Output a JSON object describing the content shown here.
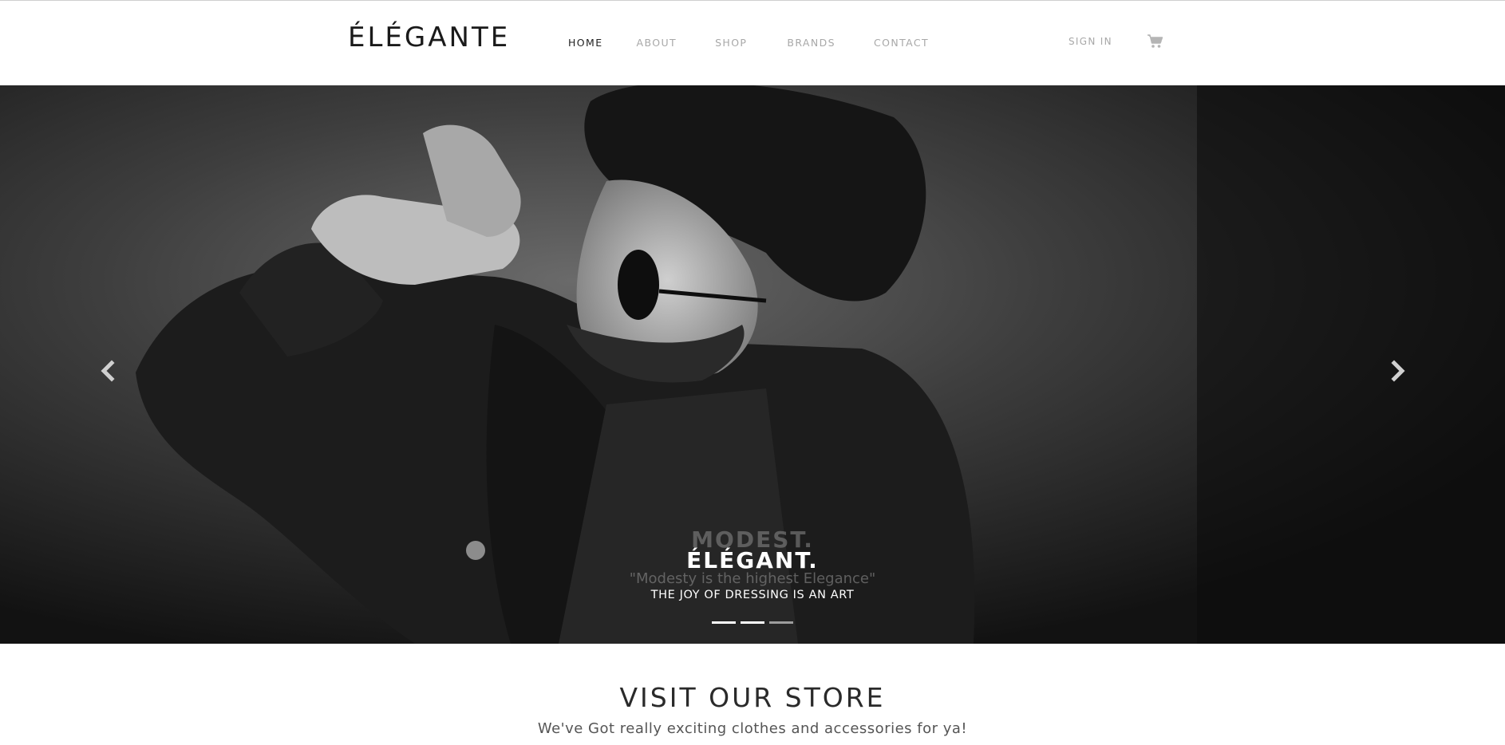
{
  "header": {
    "brand": "ÉLÉGANTE",
    "nav": [
      {
        "label": "HOME",
        "active": true
      },
      {
        "label": "ABOUT",
        "active": false
      },
      {
        "label": "SHOP",
        "active": false
      },
      {
        "label": "BRANDS",
        "active": false
      },
      {
        "label": "CONTACT",
        "active": false
      }
    ],
    "sign_in": "SIGN IN",
    "cart_icon": "shopping-cart-icon"
  },
  "hero": {
    "image_desc_icon": "hero-photo",
    "prev_icon": "chevron-left-icon",
    "next_icon": "chevron-right-icon",
    "ghost_title": "MODEST.",
    "title": "ÉLÉGANT.",
    "ghost_quote": "\"Modesty is the highest Elegance\"",
    "subtitle": "THE JOY OF DRESSING IS AN ART",
    "slides": 3,
    "active_slide": 2
  },
  "store": {
    "heading": "VISIT OUR STORE",
    "tagline": "We've Got really exciting clothes and accessories for ya!"
  },
  "colors": {
    "text_dark": "#1a1a1a",
    "nav_muted": "#a8a8a8",
    "hero_bg": "#202020"
  }
}
